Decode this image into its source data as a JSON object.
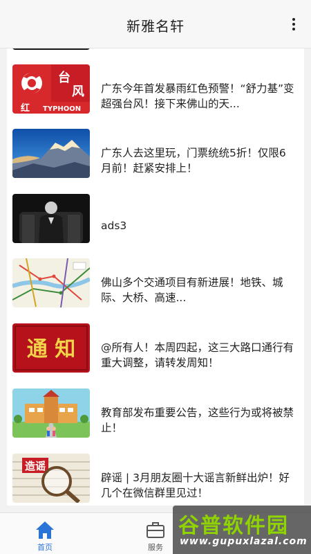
{
  "header": {
    "title": "新雅名轩"
  },
  "articles": [
    {
      "title": "广东今年首发暴雨红色预警！“舒力基”变超强台风！接下来佛山的天...",
      "thumb": "typhoon-warning-image",
      "thumb_text_1": "台",
      "thumb_text_2": "风",
      "thumb_text_3": "红",
      "thumb_text_4": "TYPHOON"
    },
    {
      "title": "广东人去这里玩，门票统统5折！仅限6月前！赶紧安排上！",
      "thumb": "snow-mountain-image"
    },
    {
      "title": "ads3",
      "thumb": "man-in-chair-image"
    },
    {
      "title": "佛山多个交通项目有新进展！地铁、城际、大桥、高速...",
      "thumb": "transit-map-image"
    },
    {
      "title": "@所有人！本周四起，这三大路口通行有重大调整，请转发周知！",
      "thumb": "notice-image",
      "thumb_text": "通 知"
    },
    {
      "title": "教育部发布重要公告，这些行为或将被禁止！",
      "thumb": "school-image"
    },
    {
      "title": "辟谣 | 3月朋友圈十大谣言新鲜出炉！好几个在微信群里见过！",
      "thumb": "rumor-debunk-image",
      "thumb_text": "造谣"
    }
  ],
  "tabs": [
    {
      "label": "首页",
      "icon": "home-icon",
      "active": true
    },
    {
      "label": "服务",
      "icon": "toolbox-icon",
      "active": false
    }
  ],
  "watermark": {
    "text": "谷普软件园",
    "url": "www.gupuxlazal.com"
  },
  "colors": {
    "accent": "#2a74d8",
    "notice_red": "#b5121b",
    "typhoon_red": "#d7282c"
  }
}
